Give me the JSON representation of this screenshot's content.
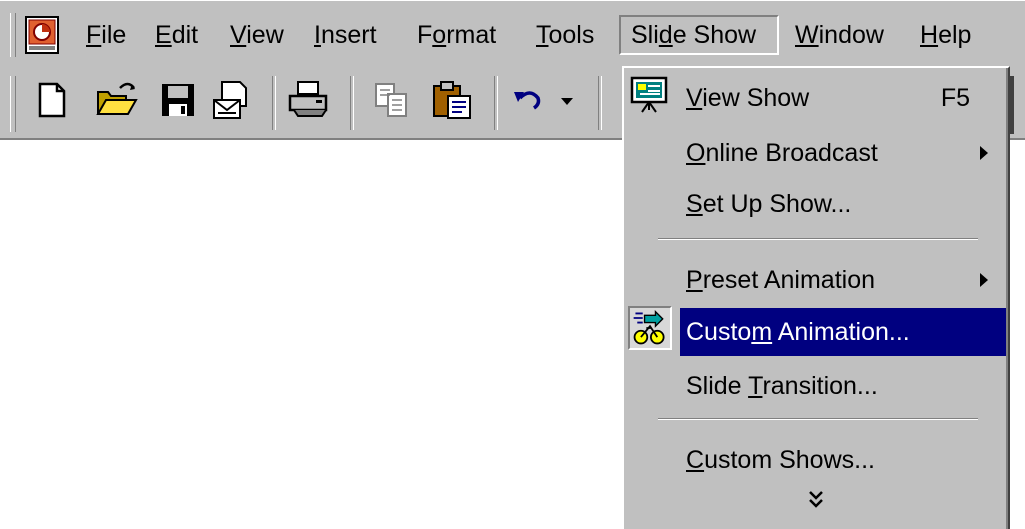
{
  "menubar": {
    "items": [
      {
        "name": "file",
        "pre": "",
        "acc": "F",
        "post": "ile"
      },
      {
        "name": "edit",
        "pre": "",
        "acc": "E",
        "post": "dit"
      },
      {
        "name": "view",
        "pre": "",
        "acc": "V",
        "post": "iew"
      },
      {
        "name": "insert",
        "pre": "",
        "acc": "I",
        "post": "nsert"
      },
      {
        "name": "format",
        "pre": "F",
        "acc": "o",
        "post": "rmat"
      },
      {
        "name": "tools",
        "pre": "",
        "acc": "T",
        "post": "ools"
      },
      {
        "name": "slide-show",
        "pre": "Sli",
        "acc": "d",
        "post": "e Show"
      },
      {
        "name": "window",
        "pre": "",
        "acc": "W",
        "post": "indow"
      },
      {
        "name": "help",
        "pre": "",
        "acc": "H",
        "post": "elp"
      }
    ]
  },
  "toolbar": {
    "buttons": [
      "new-icon",
      "open-icon",
      "save-icon",
      "email-icon",
      "print-icon",
      "copy-icon",
      "paste-icon",
      "undo-icon",
      "dropdown-arrow-icon"
    ]
  },
  "dropdown": {
    "items": [
      {
        "pre": "",
        "acc": "V",
        "post": "iew Show",
        "shortcut": "F5"
      },
      {
        "pre": "",
        "acc": "O",
        "post": "nline Broadcast",
        "shortcut": ""
      },
      {
        "pre": "",
        "acc": "S",
        "post": "et Up Show...",
        "shortcut": ""
      },
      {
        "pre": "",
        "acc": "P",
        "post": "reset Animation",
        "shortcut": ""
      },
      {
        "pre": "Custo",
        "acc": "m",
        "post": " Animation...",
        "shortcut": ""
      },
      {
        "pre": "Slide ",
        "acc": "T",
        "post": "ransition...",
        "shortcut": ""
      },
      {
        "pre": "",
        "acc": "C",
        "post": "ustom Shows...",
        "shortcut": ""
      }
    ]
  },
  "colors": {
    "face": "#c0c0c0",
    "highlight": "#000080",
    "highlight_text": "#ffffff",
    "shadow": "#808080"
  }
}
